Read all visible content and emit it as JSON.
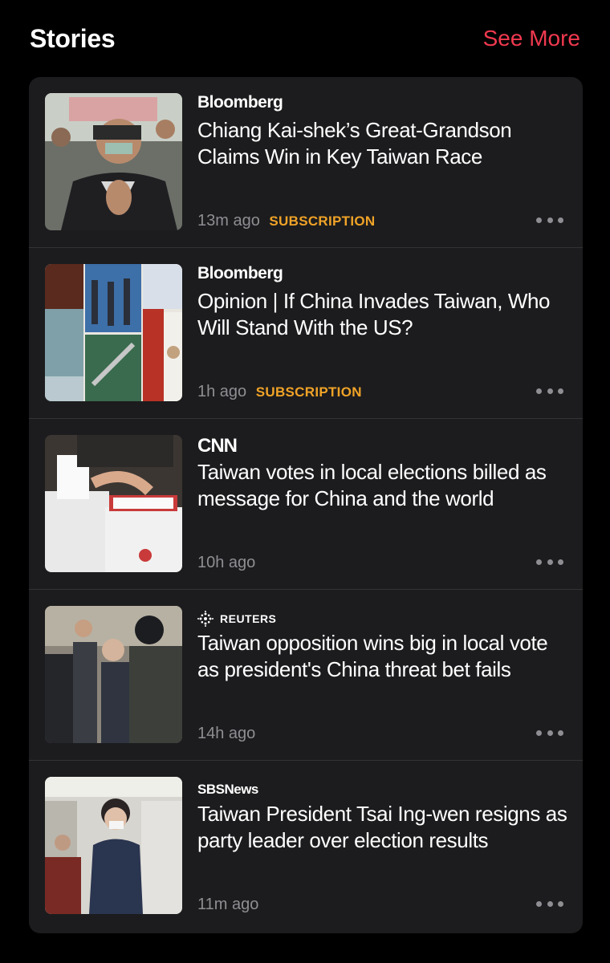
{
  "header": {
    "title": "Stories",
    "see_more": "See More"
  },
  "stories": [
    {
      "publisher": "Bloomberg",
      "headline": "Chiang Kai-shek’s Great-Grandson Claims Win in Key Taiwan Race",
      "time": "13m ago",
      "badge": "SUBSCRIPTION"
    },
    {
      "publisher": "Bloomberg",
      "headline": "Opinion | If China Invades Taiwan, Who Will Stand With the US?",
      "time": "1h ago",
      "badge": "SUBSCRIPTION"
    },
    {
      "publisher": "CNN",
      "headline": "Taiwan votes in local elections billed as message for China and the world",
      "time": "10h ago",
      "badge": ""
    },
    {
      "publisher": "REUTERS",
      "headline": "Taiwan opposition wins big in local vote as president's China threat bet fails",
      "time": "14h ago",
      "badge": ""
    },
    {
      "publisher_prefix": "SBS",
      "publisher_suffix": "News",
      "headline": "Taiwan President Tsai Ing-wen resigns as party leader over election results",
      "time": "11m ago",
      "badge": ""
    }
  ],
  "colors": {
    "accent": "#f1394f",
    "subscription": "#f0a327",
    "card": "#1c1c1e"
  }
}
